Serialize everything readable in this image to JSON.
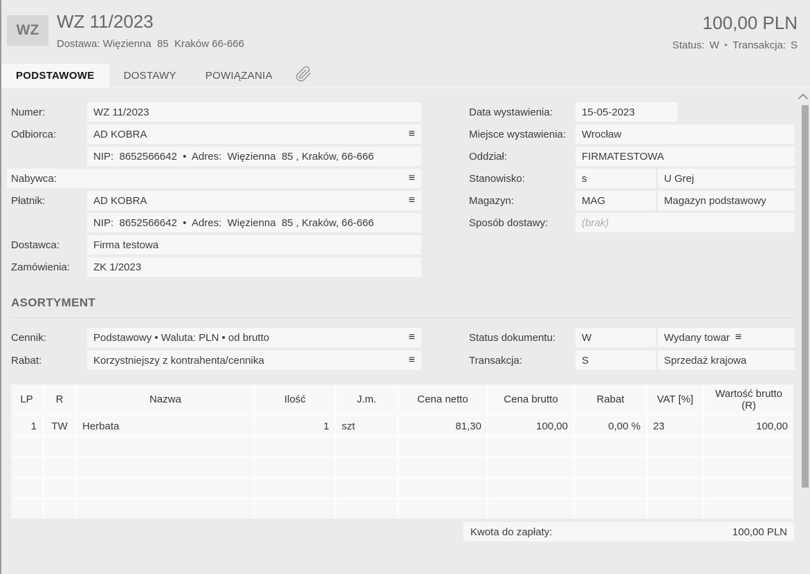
{
  "header": {
    "badge": "WZ",
    "title": "WZ 11/2023",
    "subtitle": "Dostawa: Więzienna  85  Kraków 66-666",
    "amount": "100,00 PLN",
    "status_label": "Status:",
    "status_value": "W",
    "separator": "•",
    "transaction_label": "Transakcja:",
    "transaction_value": "S"
  },
  "tabs": {
    "items": [
      {
        "label": "PODSTAWOWE",
        "active": true
      },
      {
        "label": "DOSTAWY",
        "active": false
      },
      {
        "label": "POWIĄZANIA",
        "active": false
      }
    ]
  },
  "icons": {
    "menu": "≡",
    "attachment": "paperclip",
    "scroll_up": "chevron-up"
  },
  "form": {
    "numer": {
      "label": "Numer:",
      "value": "WZ 11/2023"
    },
    "odbiorca": {
      "label": "Odbiorca:",
      "value": "AD KOBRA",
      "details": "NIP:  8652566642  •  Adres:  Więzienna  85 , Kraków, 66-666"
    },
    "nabywca": {
      "label": "Nabywca:",
      "value": ""
    },
    "platnik": {
      "label": "Płatnik:",
      "value": "AD KOBRA",
      "details": "NIP:  8652566642  •  Adres:  Więzienna  85 , Kraków, 66-666"
    },
    "dostawca": {
      "label": "Dostawca:",
      "value": "Firma testowa"
    },
    "zamowienia": {
      "label": "Zamówienia:",
      "value": "ZK 1/2023"
    },
    "data_wystawienia": {
      "label": "Data wystawienia:",
      "value": "15-05-2023"
    },
    "miejsce_wystawienia": {
      "label": "Miejsce wystawienia:",
      "value": "Wrocław"
    },
    "oddzial": {
      "label": "Oddział:",
      "value": "FIRMATESTOWA"
    },
    "stanowisko": {
      "label": "Stanowisko:",
      "code": "s",
      "name": "U Grej"
    },
    "magazyn": {
      "label": "Magazyn:",
      "code": "MAG",
      "name": "Magazyn podstawowy"
    },
    "sposob_dostawy": {
      "label": "Sposób dostawy:",
      "placeholder": "(brak)"
    }
  },
  "asortyment": {
    "heading": "ASORTYMENT",
    "cennik": {
      "label": "Cennik:",
      "value": "Podstawowy • Waluta: PLN • od brutto"
    },
    "rabat": {
      "label": "Rabat:",
      "value": "Korzystniejszy z kontrahenta/cennika"
    },
    "status_dokumentu": {
      "label": "Status dokumentu:",
      "code": "W",
      "name": "Wydany towar"
    },
    "transakcja": {
      "label": "Transakcja:",
      "code": "S",
      "name": "Sprzedaż krajowa"
    }
  },
  "table": {
    "columns": [
      "LP",
      "R",
      "Nazwa",
      "Ilość",
      "J.m.",
      "Cena netto",
      "Cena brutto",
      "Rabat",
      "VAT [%]",
      "Wartość brutto (R)"
    ],
    "rows": [
      [
        "1",
        "TW",
        "Herbata",
        "1",
        "szt",
        "81,30",
        "100,00",
        "0,00 %",
        "23",
        "100,00"
      ]
    ],
    "empty_row_count": 4
  },
  "footer": {
    "label": "Kwota do zapłaty:",
    "value": "100,00 PLN"
  },
  "colors": {
    "background": "#ebebeb",
    "field_background": "#f7f7f7",
    "text": "#3b3b3b",
    "muted_text": "#666666",
    "badge_background": "#d8d8d8"
  }
}
